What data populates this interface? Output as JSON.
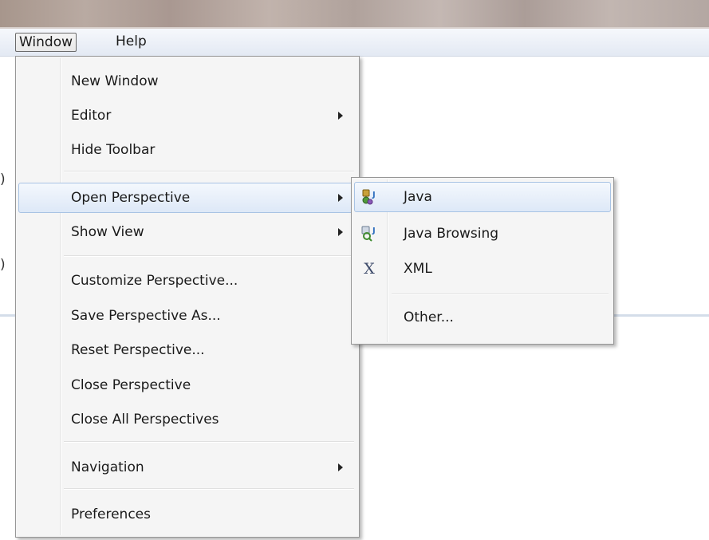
{
  "menubar": {
    "items": [
      {
        "label": "Window"
      },
      {
        "label": "Help"
      }
    ]
  },
  "window_menu": {
    "items": [
      {
        "label": "New Window"
      },
      {
        "label": "Editor"
      },
      {
        "label": "Hide Toolbar"
      },
      {
        "label": "Open Perspective"
      },
      {
        "label": "Show View"
      },
      {
        "label": "Customize Perspective..."
      },
      {
        "label": "Save Perspective As..."
      },
      {
        "label": "Reset Perspective..."
      },
      {
        "label": "Close Perspective"
      },
      {
        "label": "Close All Perspectives"
      },
      {
        "label": "Navigation"
      },
      {
        "label": "Preferences"
      }
    ]
  },
  "perspective_submenu": {
    "items": [
      {
        "label": "Java",
        "icon": "java-perspective-icon",
        "icon_glyph": "J"
      },
      {
        "label": "Java Browsing",
        "icon": "java-browsing-perspective-icon",
        "icon_glyph": "J"
      },
      {
        "label": "XML",
        "icon": "xml-perspective-icon",
        "icon_glyph": "X"
      },
      {
        "label": "Other..."
      }
    ]
  },
  "background": {
    "glyphs": [
      ")",
      ")"
    ]
  },
  "colors": {
    "menu_background": "#f5f5f5",
    "highlight_border": "#a8c3e4",
    "highlight_fill": "#dde8f7",
    "menubar_background": "#e3e9f3"
  }
}
